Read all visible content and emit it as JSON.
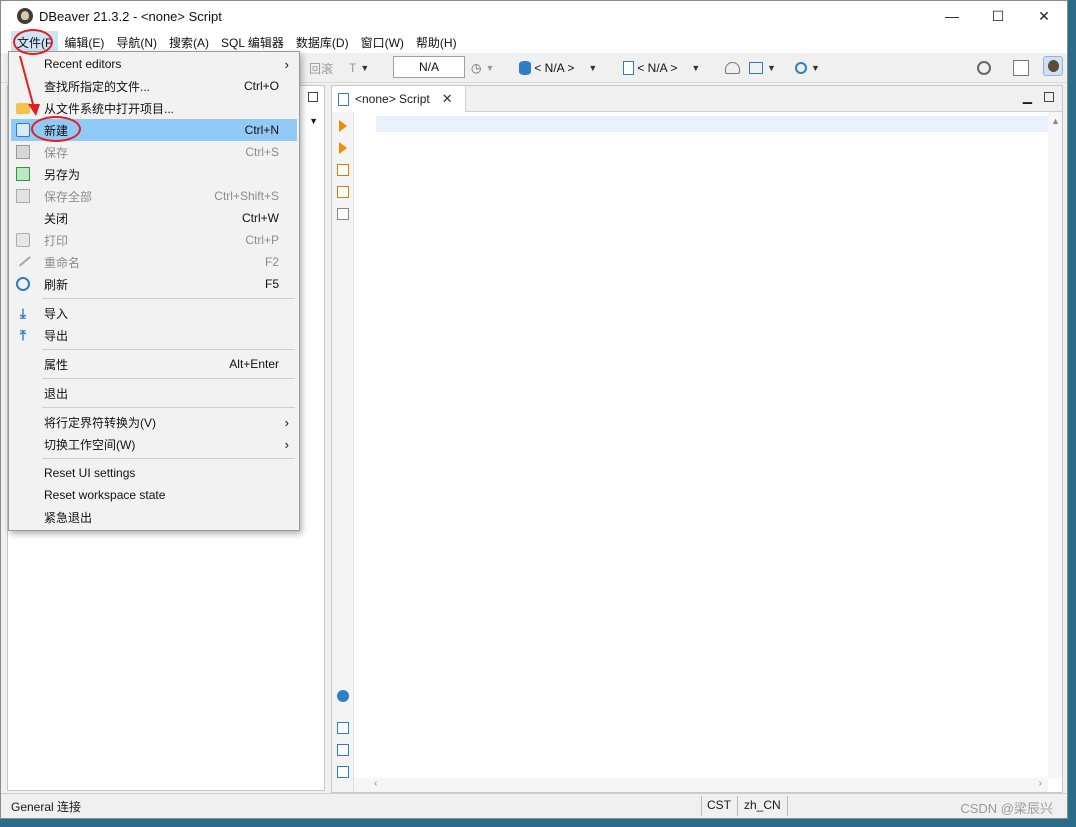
{
  "window": {
    "title": "DBeaver 21.3.2 - <none> Script",
    "minimize": "—",
    "maximize": "☐",
    "close": "✕"
  },
  "menubar": [
    {
      "label": "文件(F"
    },
    {
      "label": "编辑(E)"
    },
    {
      "label": "导航(N)"
    },
    {
      "label": "搜索(A)"
    },
    {
      "label": "SQL 编辑器"
    },
    {
      "label": "数据库(D)"
    },
    {
      "label": "窗口(W)"
    },
    {
      "label": "帮助(H)"
    }
  ],
  "toolbar": {
    "rollback": "回滚",
    "transaction_mode": "N/A",
    "datasource": "< N/A >",
    "schema": "< N/A >"
  },
  "editor": {
    "tab_title": "<none> Script",
    "tab_close": "✕"
  },
  "file_menu": [
    {
      "label": "Recent editors",
      "shortcut": "",
      "submenu": true,
      "enabled": true,
      "icon": ""
    },
    {
      "label": "查找所指定的文件...",
      "shortcut": "Ctrl+O",
      "submenu": false,
      "enabled": true,
      "icon": ""
    },
    {
      "label": "从文件系统中打开项目...",
      "shortcut": "",
      "submenu": false,
      "enabled": true,
      "icon": "folder-icon"
    },
    {
      "label": "新建",
      "shortcut": "Ctrl+N",
      "submenu": false,
      "enabled": true,
      "icon": "new-object-icon",
      "highlighted": true
    },
    {
      "label": "保存",
      "shortcut": "Ctrl+S",
      "submenu": false,
      "enabled": false,
      "icon": "save-icon"
    },
    {
      "label": "另存为",
      "shortcut": "",
      "submenu": false,
      "enabled": true,
      "icon": "save-as-icon"
    },
    {
      "label": "保存全部",
      "shortcut": "Ctrl+Shift+S",
      "submenu": false,
      "enabled": false,
      "icon": "save-all-icon"
    },
    {
      "label": "关闭",
      "shortcut": "Ctrl+W",
      "submenu": false,
      "enabled": true,
      "icon": ""
    },
    {
      "label": "打印",
      "shortcut": "Ctrl+P",
      "submenu": false,
      "enabled": false,
      "icon": "print-icon"
    },
    {
      "label": "重命名",
      "shortcut": "F2",
      "submenu": false,
      "enabled": false,
      "icon": "rename-icon"
    },
    {
      "label": "刷新",
      "shortcut": "F5",
      "submenu": false,
      "enabled": true,
      "icon": "refresh-icon"
    },
    {
      "label": "导入",
      "shortcut": "",
      "submenu": false,
      "enabled": true,
      "icon": "import-icon"
    },
    {
      "label": "导出",
      "shortcut": "",
      "submenu": false,
      "enabled": true,
      "icon": "export-icon"
    },
    {
      "label": "属性",
      "shortcut": "Alt+Enter",
      "submenu": false,
      "enabled": true,
      "icon": ""
    },
    {
      "label": "退出",
      "shortcut": "",
      "submenu": false,
      "enabled": true,
      "icon": ""
    },
    {
      "label": "将行定界符转换为(V)",
      "shortcut": "",
      "submenu": true,
      "enabled": true,
      "icon": ""
    },
    {
      "label": "切换工作空间(W)",
      "shortcut": "",
      "submenu": true,
      "enabled": true,
      "icon": ""
    },
    {
      "label": "Reset UI settings",
      "shortcut": "",
      "submenu": false,
      "enabled": true,
      "icon": ""
    },
    {
      "label": "Reset workspace state",
      "shortcut": "",
      "submenu": false,
      "enabled": true,
      "icon": ""
    },
    {
      "label": "紧急退出",
      "shortcut": "",
      "submenu": false,
      "enabled": true,
      "icon": ""
    }
  ],
  "statusbar": {
    "left": "General 连接",
    "timezone": "CST",
    "locale": "zh_CN",
    "watermark": "CSDN @梁辰兴"
  },
  "colors": {
    "highlight": "#91c9f7",
    "annotation": "#e02020",
    "accent": "#2f7dc4"
  }
}
